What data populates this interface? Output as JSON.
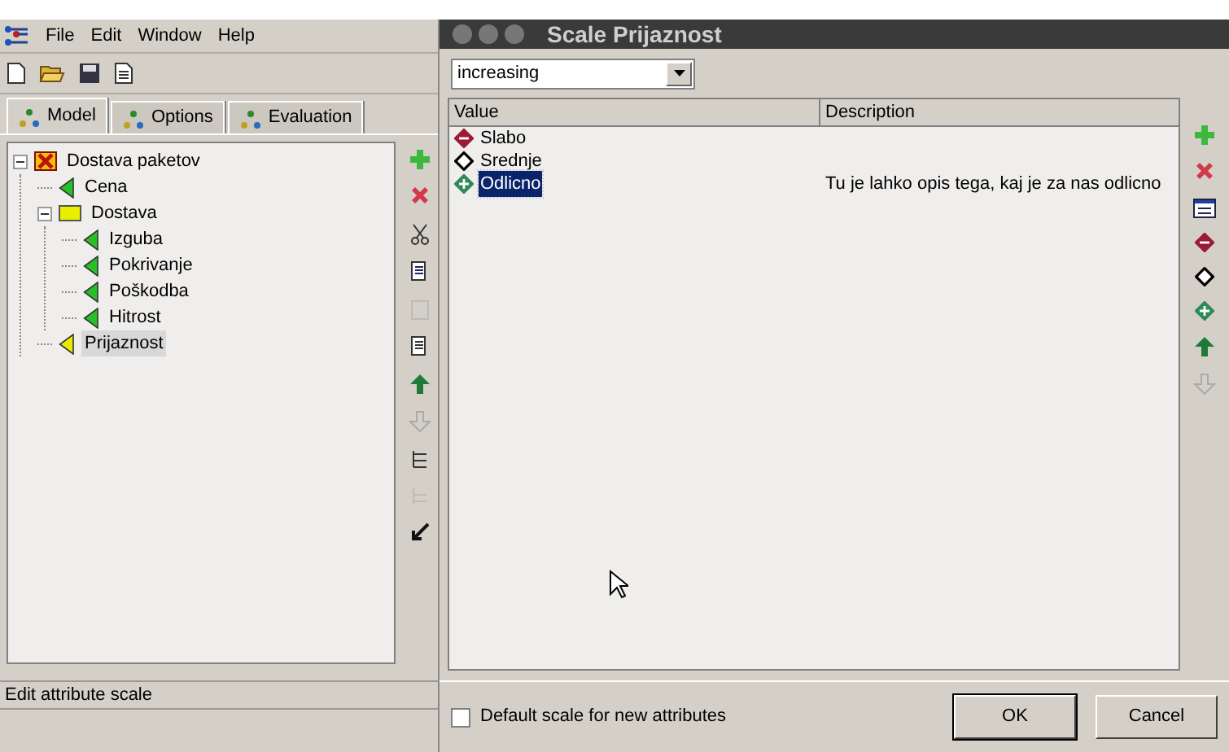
{
  "main_window": {
    "menu": [
      "File",
      "Edit",
      "Window",
      "Help"
    ],
    "tabs": [
      {
        "label": "Model",
        "selected": true
      },
      {
        "label": "Options",
        "selected": false
      },
      {
        "label": "Evaluation",
        "selected": false
      }
    ],
    "tree": [
      {
        "label": "Dostava paketov",
        "kind": "aggregate",
        "selected": false,
        "expanded": true,
        "children": [
          {
            "label": "Cena",
            "kind": "attribute",
            "selected": false
          },
          {
            "label": "Dostava",
            "kind": "group",
            "selected": false,
            "expanded": true,
            "children": [
              {
                "label": "Izguba",
                "kind": "attribute",
                "selected": false
              },
              {
                "label": "Pokrivanje",
                "kind": "attribute",
                "selected": false
              },
              {
                "label": "Poškodba",
                "kind": "attribute",
                "selected": false
              },
              {
                "label": "Hitrost",
                "kind": "attribute",
                "selected": false
              }
            ]
          },
          {
            "label": "Prijaznost",
            "kind": "attribute",
            "selected": true
          }
        ]
      }
    ],
    "status_bar": "Edit attribute scale"
  },
  "dialog": {
    "title": "Scale Prijaznost",
    "order": "increasing",
    "columns": [
      "Value",
      "Description"
    ],
    "rows": [
      {
        "value": "Slabo",
        "kind": "bad",
        "description": "",
        "selected": false
      },
      {
        "value": "Srednje",
        "kind": "neutral",
        "description": "",
        "selected": false
      },
      {
        "value": "Odlicno",
        "kind": "good",
        "description": "Tu je lahko opis tega, kaj je za nas odlicno",
        "selected": true
      }
    ],
    "default_scale": {
      "label": "Default scale for new attributes",
      "checked": false
    },
    "buttons": [
      "OK",
      "Cancel"
    ]
  }
}
